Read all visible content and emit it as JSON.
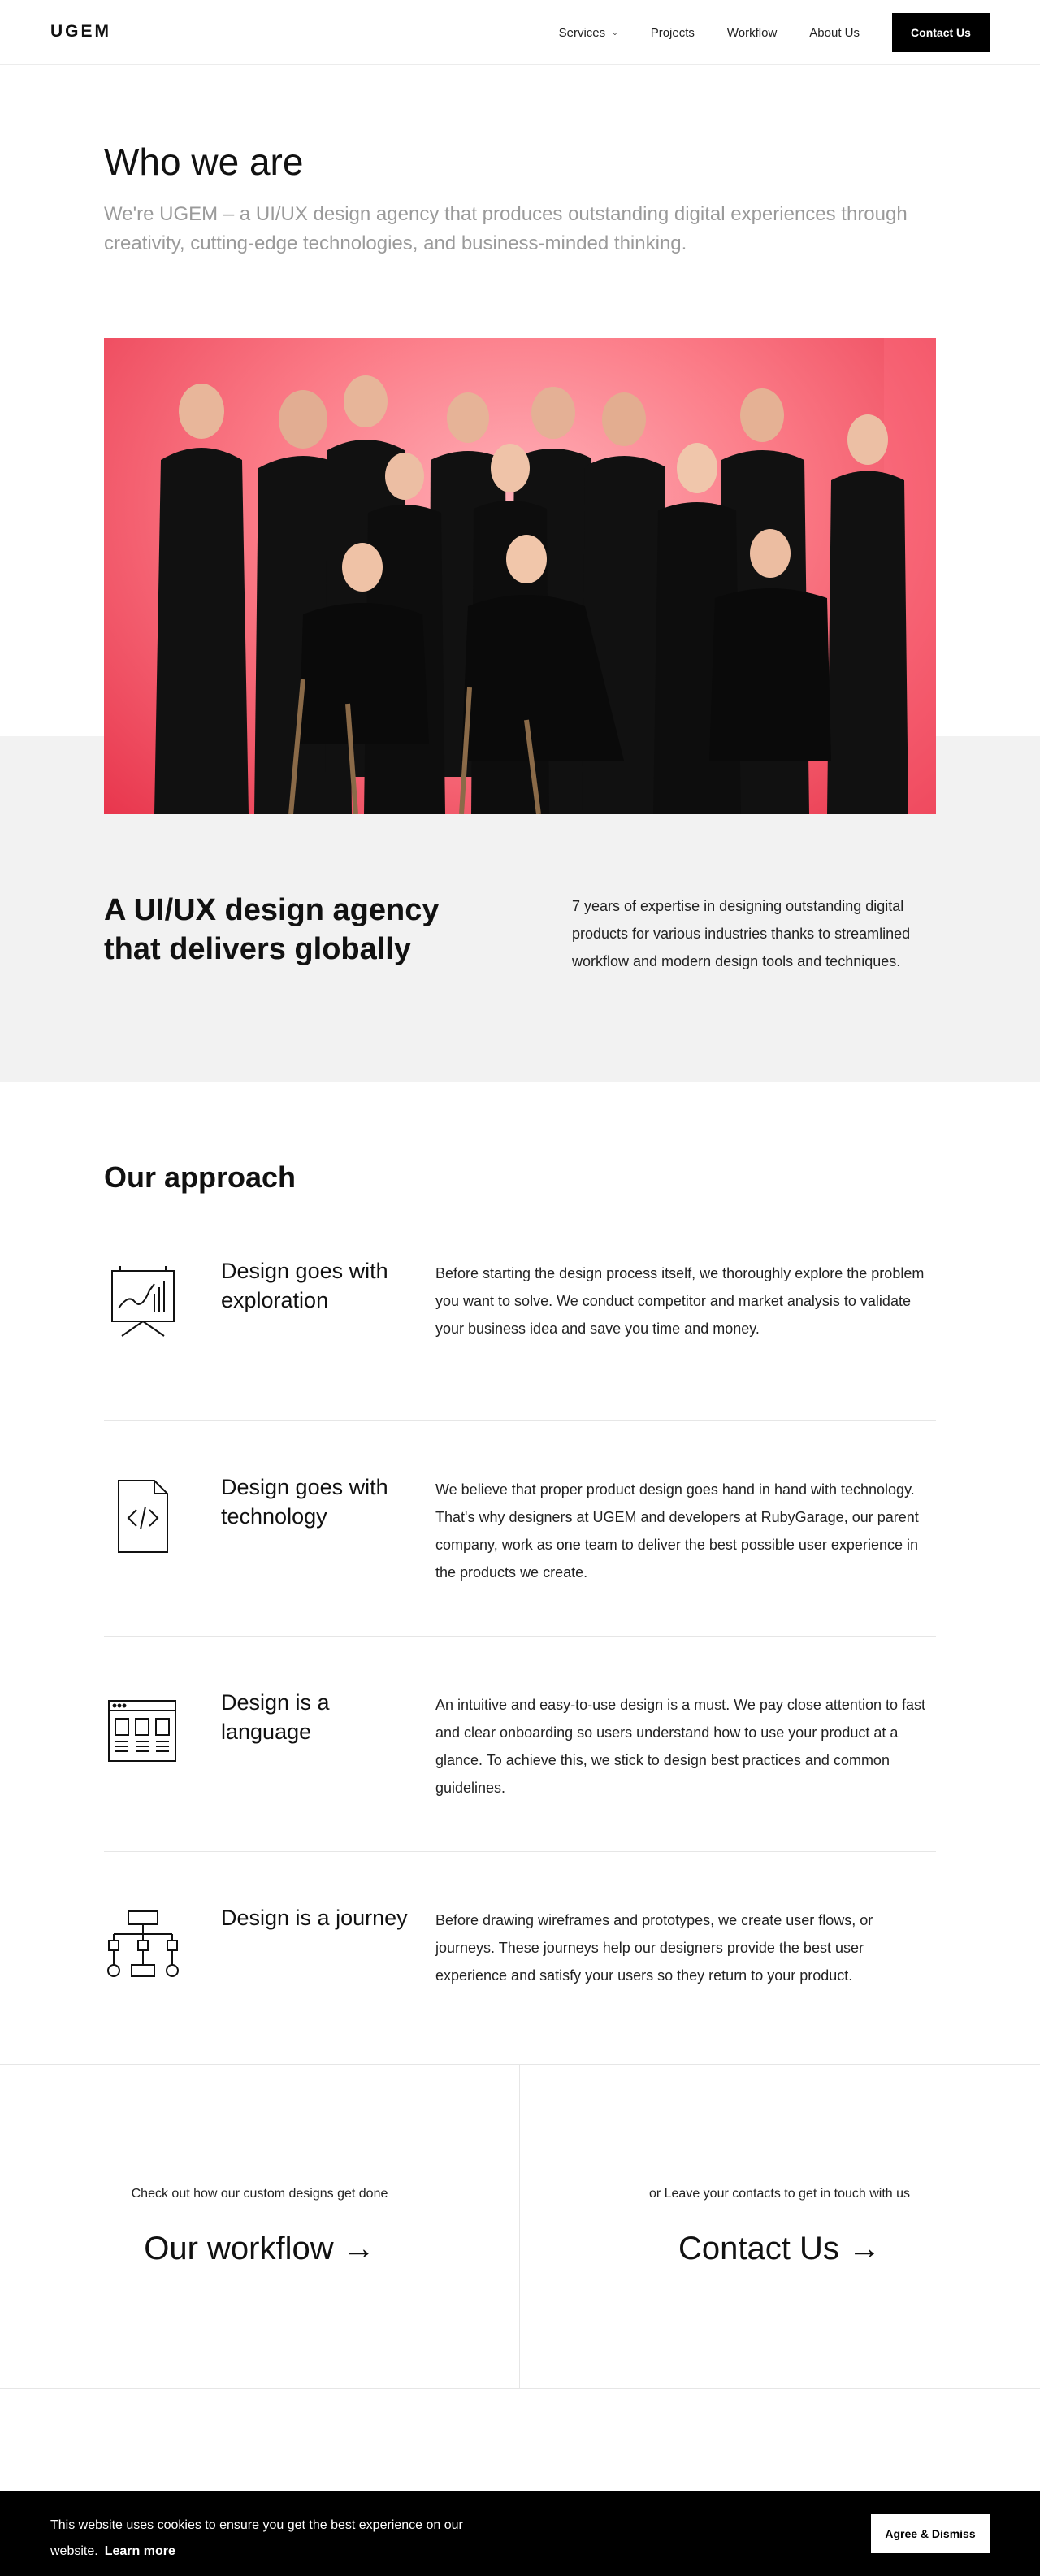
{
  "header": {
    "logo": "UGEM",
    "nav": [
      {
        "label": "Services",
        "icon": "chevron-down-icon"
      },
      {
        "label": "Projects"
      },
      {
        "label": "Workflow"
      },
      {
        "label": "About Us"
      }
    ],
    "contact_label": "Contact Us"
  },
  "hero": {
    "title": "Who we are",
    "subtitle": "We're UGEM – a UI/UX design agency that produces outstanding digital experiences through creativity, cutting-edge technologies, and business-minded thinking."
  },
  "agency": {
    "title": "A UI/UX design agency that delivers globally",
    "text": "7 years of expertise in designing outstanding digital products for various industries thanks to streamlined workflow and modern design tools and techniques."
  },
  "approach": {
    "title": "Our approach",
    "items": [
      {
        "icon": "presentation-chart-icon",
        "title": "Design goes with exploration",
        "text": "Before starting the design process itself, we thoroughly explore the problem you want to solve. We conduct competitor and market analysis to validate your business idea and save you time and money."
      },
      {
        "icon": "code-file-icon",
        "title": "Design goes with technology",
        "text": "We believe that proper product design goes hand in hand with technology. That's why designers at UGEM and developers at RubyGarage, our parent company, work as one team to deliver the best possible user experience in the products we create."
      },
      {
        "icon": "browser-layout-icon",
        "title": "Design is a language",
        "text": "An intuitive and easy-to-use design is a must. We pay close attention to fast and clear onboarding so users understand how to use your product at a glance. To achieve this, we stick to design best practices and common guidelines."
      },
      {
        "icon": "flowchart-icon",
        "title": "Design is a journey",
        "text": "Before drawing wireframes and prototypes, we create user flows, or journeys. These journeys help our designers provide the best user experience and satisfy your users so they return to your product."
      }
    ]
  },
  "cta": {
    "left": {
      "small": "Check out how our custom designs get done",
      "big": "Our workflow",
      "arrow": "→"
    },
    "right": {
      "small": "or Leave your contacts to get in touch with us",
      "big": "Contact Us",
      "arrow": "→"
    }
  },
  "cookie": {
    "text": "This website uses cookies to ensure you get the best experience on our website.",
    "learn_more": "Learn more",
    "button": "Agree & Dismiss"
  }
}
